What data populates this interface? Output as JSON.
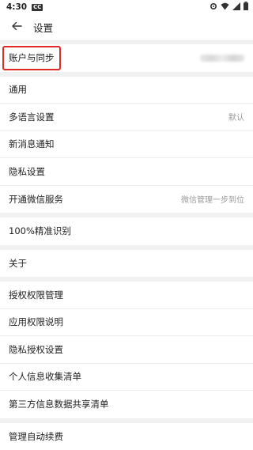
{
  "status_bar": {
    "time": "4:30",
    "notification_badge": "CC",
    "icons": [
      "settings-gear-icon",
      "wifi-icon",
      "signal-icon",
      "battery-icon"
    ]
  },
  "app_bar": {
    "title": "设置",
    "back_icon": "arrow-left-icon"
  },
  "groups": [
    {
      "items": [
        {
          "label": "账户与同步",
          "value": "",
          "highlighted": true,
          "value_blurred": true
        }
      ]
    },
    {
      "items": [
        {
          "label": "通用",
          "value": ""
        },
        {
          "label": "多语言设置",
          "value": "默认"
        },
        {
          "label": "新消息通知",
          "value": ""
        },
        {
          "label": "隐私设置",
          "value": ""
        },
        {
          "label": "开通微信服务",
          "value": "微信管理一步到位"
        }
      ]
    },
    {
      "items": [
        {
          "label": "100%精准识别",
          "value": ""
        }
      ]
    },
    {
      "items": [
        {
          "label": "关于",
          "value": ""
        }
      ]
    },
    {
      "items": [
        {
          "label": "授权权限管理",
          "value": ""
        },
        {
          "label": "应用权限说明",
          "value": ""
        },
        {
          "label": "隐私授权设置",
          "value": ""
        },
        {
          "label": "个人信息收集清单",
          "value": ""
        },
        {
          "label": "第三方信息数据共享清单",
          "value": ""
        }
      ]
    },
    {
      "items": [
        {
          "label": "管理自动续费",
          "value": ""
        }
      ]
    }
  ],
  "colors": {
    "highlight": "#e02a2a",
    "background": "#f1f1f1",
    "secondary_text": "#9a9a9a"
  }
}
